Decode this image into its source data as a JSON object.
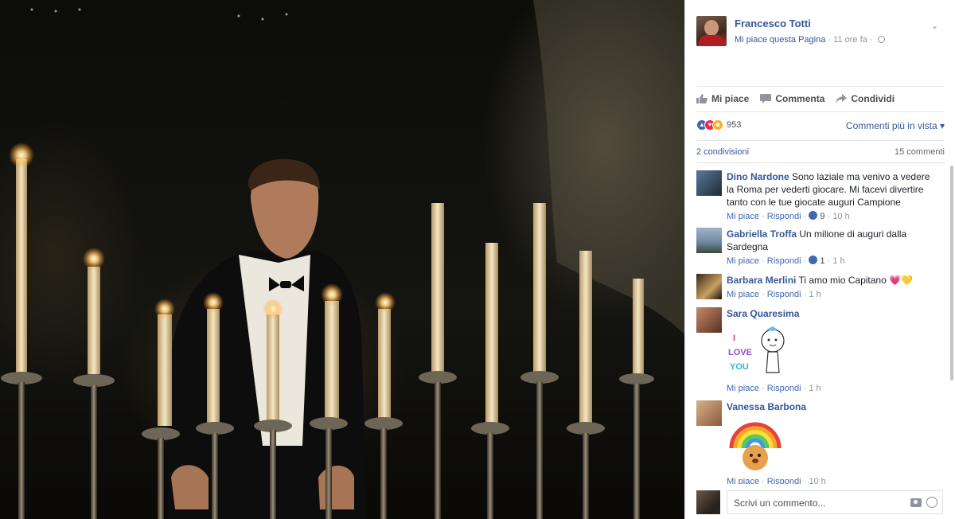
{
  "post": {
    "page_name": "Francesco Totti",
    "like_page_link": "Mi piace questa Pagina",
    "time": " · 11 ore fa · "
  },
  "actions": {
    "like": "Mi piace",
    "comment": "Commenta",
    "share": "Condividi"
  },
  "reactions": {
    "count": "953",
    "order_label": "Commenti più in vista ▾"
  },
  "stats": {
    "shares": "2 condivisioni",
    "comments": "15 commenti"
  },
  "comments": [
    {
      "author": "Dino Nardone",
      "text": " Sono laziale ma venivo a vedere la Roma per vederti giocare. Mi facevi divertire tanto con le tue giocate auguri Campione",
      "like": "Mi piace",
      "reply": "Rispondi",
      "likes": "9",
      "time": "10 h"
    },
    {
      "author": "Gabriella Troffa",
      "text": " Un milione di auguri dalla Sardegna",
      "like": "Mi piace",
      "reply": "Rispondi",
      "likes": "1",
      "time": "1 h"
    },
    {
      "author": "Barbara Merlini",
      "text": " Ti amo mio Capitano 💗💛",
      "like": "Mi piace",
      "reply": "Rispondi",
      "time": "1 h"
    },
    {
      "author": "Sara Quaresima",
      "text": "",
      "sticker_text": [
        "I",
        "LOVE",
        "YOU"
      ],
      "like": "Mi piace",
      "reply": "Rispondi",
      "time": "1 h"
    },
    {
      "author": "Vanessa Barbona",
      "text": "",
      "like": "Mi piace",
      "reply": "Rispondi",
      "time": "10 h"
    }
  ],
  "composer": {
    "placeholder": "Scrivi un commento..."
  },
  "colors": {
    "link": "#365899",
    "like_blue": "#4267b2",
    "love_red": "#f0284a",
    "haha_yellow": "#f7b125",
    "meta_gray": "#90949c"
  },
  "icons": [
    "like-thumb-icon",
    "comment-bubble-icon",
    "share-arrow-icon",
    "globe-icon",
    "chevron-down-icon",
    "camera-icon",
    "emoji-icon"
  ]
}
